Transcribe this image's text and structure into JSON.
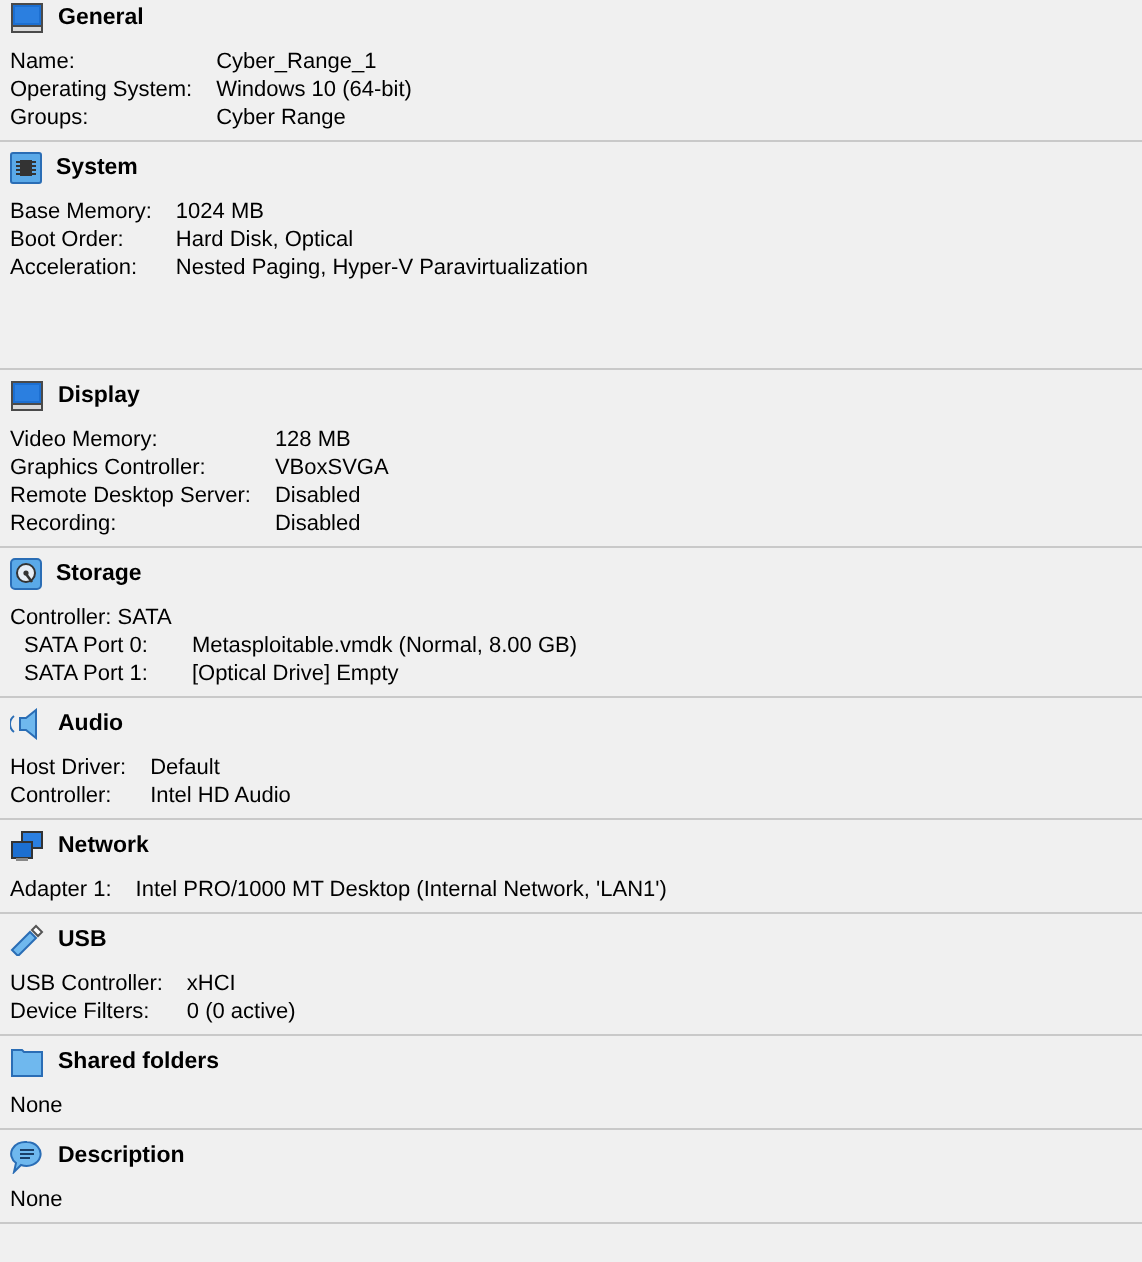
{
  "sections": [
    {
      "kind": "general",
      "title": "General",
      "rows": [
        {
          "label": "Name:",
          "value": "Cyber_Range_1"
        },
        {
          "label": "Operating System:",
          "value": "Windows 10 (64-bit)"
        },
        {
          "label": "Groups:",
          "value": "Cyber Range"
        }
      ]
    },
    {
      "kind": "system",
      "title": "System",
      "rows": [
        {
          "label": "Base Memory:",
          "value": "1024 MB"
        },
        {
          "label": "Boot Order:",
          "value": "Hard Disk, Optical"
        },
        {
          "label": "Acceleration:",
          "value": "Nested Paging, Hyper-V Paravirtualization"
        }
      ]
    },
    {
      "kind": "display",
      "title": "Display",
      "rows": [
        {
          "label": "Video Memory:",
          "value": "128 MB"
        },
        {
          "label": "Graphics Controller:",
          "value": "VBoxSVGA"
        },
        {
          "label": "Remote Desktop Server:",
          "value": "Disabled"
        },
        {
          "label": "Recording:",
          "value": "Disabled"
        }
      ]
    },
    {
      "kind": "storage",
      "title": "Storage",
      "rows": [
        {
          "text": "Controller: SATA",
          "children": [
            {
              "label": "SATA Port 0:",
              "value": "Metasploitable.vmdk (Normal, 8.00 GB)"
            },
            {
              "label": "SATA Port 1:",
              "value": "[Optical Drive] Empty"
            }
          ]
        }
      ]
    },
    {
      "kind": "audio",
      "title": "Audio",
      "rows": [
        {
          "label": "Host Driver:",
          "value": "Default"
        },
        {
          "label": "Controller:",
          "value": "Intel HD Audio"
        }
      ]
    },
    {
      "kind": "network",
      "title": "Network",
      "rows": [
        {
          "label": "Adapter 1:",
          "value": "Intel PRO/1000 MT Desktop (Internal Network, 'LAN1')"
        }
      ]
    },
    {
      "kind": "usb",
      "title": "USB",
      "rows": [
        {
          "label": "USB Controller:",
          "value": "xHCI"
        },
        {
          "label": "Device Filters:",
          "value": "0 (0 active)"
        }
      ]
    },
    {
      "kind": "shared",
      "title": "Shared folders",
      "rows": [
        {
          "text": "None"
        }
      ]
    },
    {
      "kind": "description",
      "title": "Description",
      "rows": [
        {
          "text": "None"
        }
      ]
    }
  ]
}
